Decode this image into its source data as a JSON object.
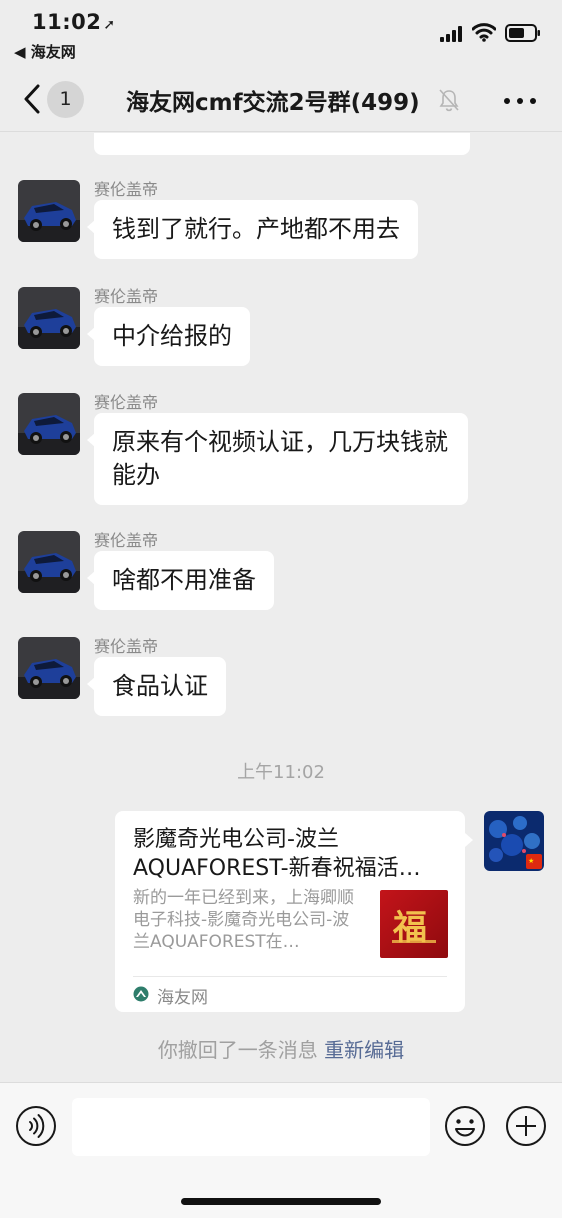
{
  "status_bar": {
    "time": "11:02",
    "location_arrow": "location-arrow-icon",
    "back_to_app": "◀ 海友网"
  },
  "nav": {
    "back_icon": "chevron-left-icon",
    "unread_count": "1",
    "title": "海友网cmf交流2号群(499)",
    "mute_icon": "bell-off-icon",
    "more_icon": "more-dots-icon"
  },
  "messages": [
    {
      "sender": "赛伦盖帝",
      "text": "钱到了就行。产地都不用去"
    },
    {
      "sender": "赛伦盖帝",
      "text": "中介给报的"
    },
    {
      "sender": "赛伦盖帝",
      "text": "原来有个视频认证，几万块钱就能办"
    },
    {
      "sender": "赛伦盖帝",
      "text": "啥都不用准备"
    },
    {
      "sender": "赛伦盖帝",
      "text": "食品认证"
    }
  ],
  "timestamp": "上午11:02",
  "link_card": {
    "title_line1": "影魔奇光电公司-波兰",
    "title_line2": "AQUAFOREST-新春祝福活…",
    "description": "新的一年已经到来，上海卿顺电子科技-影魔奇光电公司-波兰AQUAFOREST在…",
    "thumb_char": "福",
    "source": "海友网"
  },
  "recall": {
    "text": "你撤回了一条消息",
    "action": "重新编辑"
  },
  "input_bar": {
    "voice_icon": "voice-icon",
    "emoji_icon": "emoji-icon",
    "plus_icon": "plus-icon"
  },
  "colors": {
    "background": "#ededed",
    "bubble": "#ffffff",
    "link_blue": "#576b95"
  }
}
